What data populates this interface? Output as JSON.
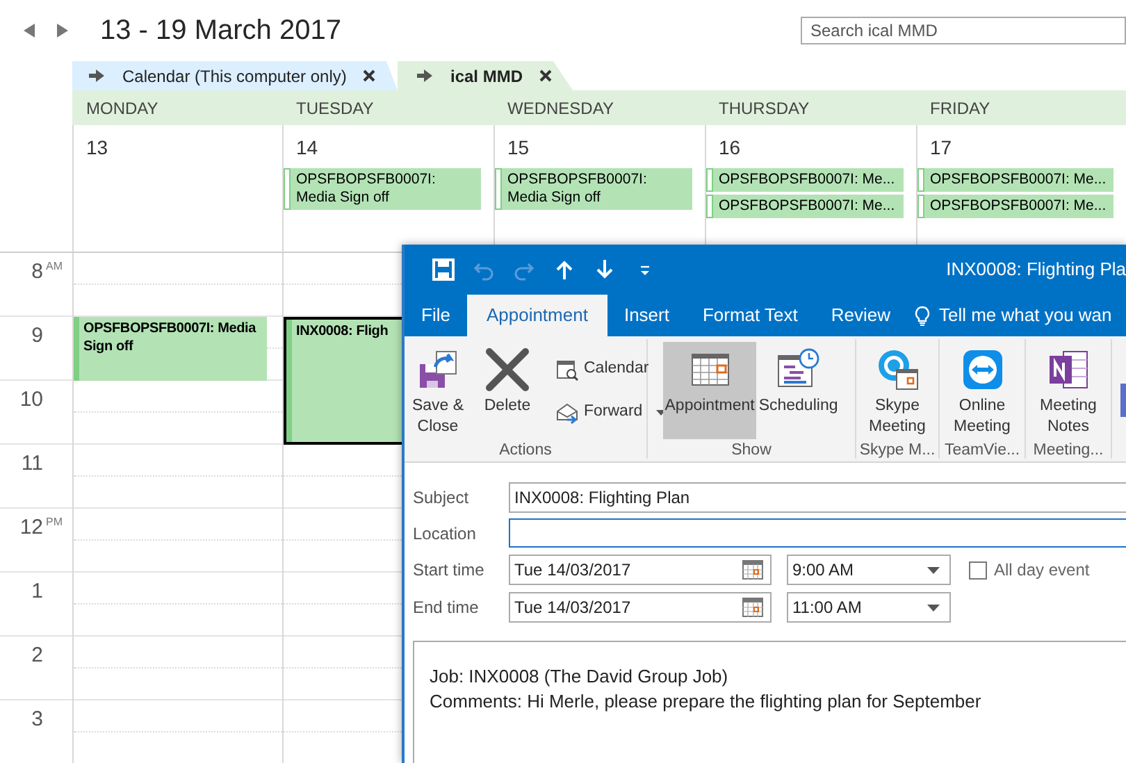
{
  "header": {
    "title": "13 - 19 March 2017",
    "search": {
      "placeholder": "Search ical MMD"
    }
  },
  "calendar_tabs": [
    {
      "label": "Calendar (This computer only)",
      "selected": false
    },
    {
      "label": "ical MMD",
      "selected": true
    }
  ],
  "days": [
    {
      "name": "MONDAY",
      "date": "13"
    },
    {
      "name": "TUESDAY",
      "date": "14",
      "all_day_events": [
        {
          "title": "OPSFBOPSFB0007I: Media Sign off"
        }
      ]
    },
    {
      "name": "WEDNESDAY",
      "date": "15",
      "all_day_events": [
        {
          "title": "OPSFBOPSFB0007I: Media Sign off"
        }
      ]
    },
    {
      "name": "THURSDAY",
      "date": "16",
      "all_day_events": [
        {
          "title": "OPSFBOPSFB0007I: Me..."
        },
        {
          "title": "OPSFBOPSFB0007I: Me..."
        }
      ]
    },
    {
      "name": "FRIDAY",
      "date": "17",
      "all_day_events": [
        {
          "title": "OPSFBOPSFB0007I: Me..."
        },
        {
          "title": "OPSFBOPSFB0007I: Me..."
        }
      ]
    }
  ],
  "hours": [
    {
      "label": "8",
      "suffix": "AM"
    },
    {
      "label": "9",
      "events": [
        {
          "kind": "one_hour",
          "title": "OPSFBOPSFB0007I: Media Sign off",
          "selected": false
        },
        {
          "kind": "two_hours",
          "title": "INX0008: Fligh",
          "selected": true
        }
      ]
    },
    {
      "label": "10"
    },
    {
      "label": "11"
    },
    {
      "label": "12",
      "suffix": "PM"
    },
    {
      "label": "1"
    },
    {
      "label": "2"
    },
    {
      "label": "3"
    }
  ],
  "appointment_window": {
    "title": "INX0008: Flighting Pla",
    "quick_access": [
      {
        "kind": "save",
        "disabled": false
      },
      {
        "kind": "undo",
        "disabled": true
      },
      {
        "kind": "redo",
        "disabled": true
      },
      {
        "kind": "up",
        "disabled": false
      },
      {
        "kind": "down",
        "disabled": false
      },
      {
        "kind": "customize",
        "disabled": false
      }
    ],
    "tabs": [
      {
        "label": "File",
        "selected": false
      },
      {
        "label": "Appointment",
        "selected": true
      },
      {
        "label": "Insert",
        "selected": false
      },
      {
        "label": "Format Text",
        "selected": false
      },
      {
        "label": "Review",
        "selected": false
      }
    ],
    "tell_me": "Tell me what you wan",
    "ribbon_groups": [
      {
        "label": "Actions",
        "buttons": [
          {
            "kind": "save_close",
            "label": "Save & Close",
            "selected": false
          },
          {
            "kind": "delete",
            "label": "Delete",
            "selected": false
          },
          {
            "kind": "calendar",
            "label": "Calendar",
            "selected": false
          },
          {
            "kind": "forward",
            "label": "Forward",
            "selected": false,
            "dropdown": true
          }
        ]
      },
      {
        "label": "Show",
        "buttons": [
          {
            "kind": "appointment",
            "label": "Appointment",
            "selected": true
          },
          {
            "kind": "scheduling",
            "label": "Scheduling",
            "selected": false
          }
        ]
      },
      {
        "label": "Skype M...",
        "buttons": [
          {
            "kind": "skype",
            "label": "Skype Meeting",
            "selected": false
          }
        ]
      },
      {
        "label": "TeamVie...",
        "buttons": [
          {
            "kind": "teamviewer",
            "label": "Online Meeting",
            "selected": false
          }
        ]
      },
      {
        "label": "Meeting...",
        "buttons": [
          {
            "kind": "onenote",
            "label": "Meeting Notes",
            "selected": false
          }
        ]
      }
    ],
    "form": {
      "subject": {
        "label": "Subject",
        "value": "INX0008: Flighting Plan"
      },
      "location": {
        "label": "Location",
        "focused": true
      },
      "start": {
        "label": "Start time",
        "date": "Tue 14/03/2017",
        "time": "9:00 AM"
      },
      "end": {
        "label": "End time",
        "date": "Tue 14/03/2017",
        "time": "11:00 AM"
      },
      "all_day": {
        "label": "All day event",
        "checked": false
      },
      "body": [
        "Job: INX0008 (The David Group Job)",
        "Comments: Hi Merle, please prepare the flighting plan for September"
      ]
    }
  }
}
